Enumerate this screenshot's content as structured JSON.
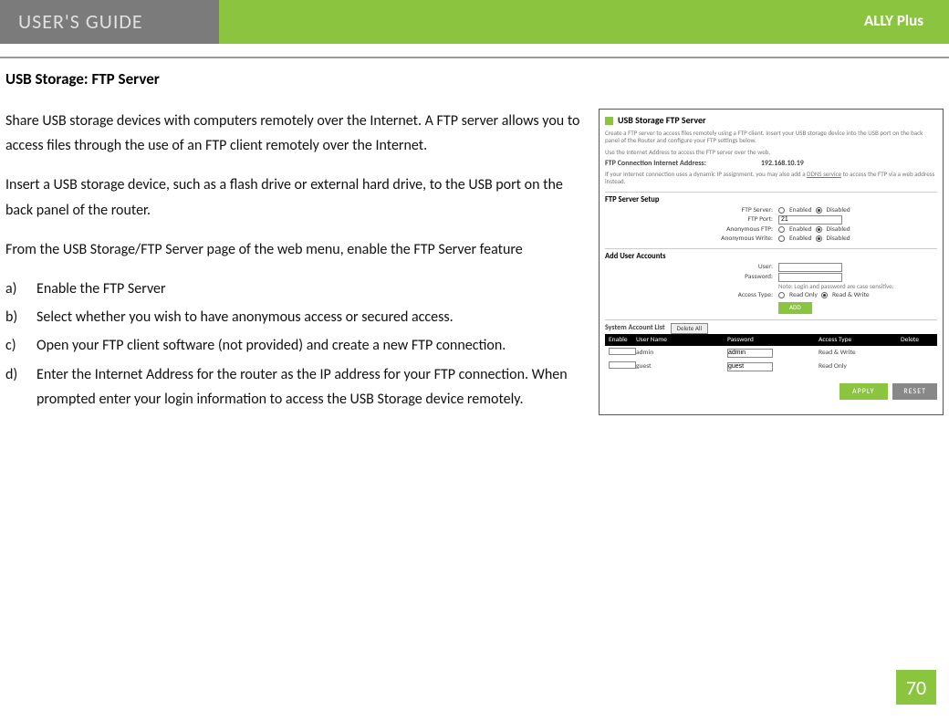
{
  "header": {
    "left": "USER'S GUIDE",
    "right": "ALLY Plus"
  },
  "section_title": "USB Storage: FTP Server",
  "para1": "Share USB storage devices with computers remotely over the Internet. A FTP server allows you to access files through the use of an FTP client remotely over the Internet.",
  "para2": "Insert a USB storage device, such as a flash drive or external hard drive, to the USB port on the back panel of the router.",
  "para3": "From the USB Storage/FTP Server page of the web menu, enable the FTP Server feature",
  "steps": [
    "Enable the FTP Server",
    "Select whether you wish to have anonymous access or secured access.",
    "Open your FTP client software (not provided) and create a new FTP connection.",
    "Enter the Internet Address for the router as the IP address for your FTP connection.  When prompted enter your login information to access the USB Storage device remotely."
  ],
  "step_markers": [
    "a)",
    "b)",
    "c)",
    "d)"
  ],
  "screenshot": {
    "title": "USB Storage FTP Server",
    "desc1": "Create a FTP server to access files remotely using a FTP client. Insert your USB storage device into the USB port on the back panel of the Router and configure your FTP settings below.",
    "desc2": "Use the Internet Address to access the FTP server over the web.",
    "addr_label": "FTP Connection Internet Address:",
    "addr_value": "192.168.10.19",
    "addr_note_pre": "If your Internet connection uses a dynamic IP assignment, you may also add a ",
    "addr_note_link": "DDNS service",
    "addr_note_post": " to access the FTP via a web address instead.",
    "setup_head": "FTP Server Setup",
    "rows": {
      "server": {
        "label": "FTP Server:",
        "enabled": "Enabled",
        "disabled": "Disabled"
      },
      "port": {
        "label": "FTP Port:",
        "value": "21"
      },
      "anonftp": {
        "label": "Anonymous FTP:",
        "enabled": "Enabled",
        "disabled": "Disabled"
      },
      "anonwrite": {
        "label": "Anonymous Write:",
        "enabled": "Enabled",
        "disabled": "Disabled"
      }
    },
    "add_head": "Add User Accounts",
    "user_label": "User:",
    "pass_label": "Password:",
    "note": "Note: Login and password are case sensitive.",
    "access_label": "Access Type:",
    "access_ro": "Read Only",
    "access_rw": "Read & Write",
    "add_btn": "ADD",
    "sys_head": "System Account List",
    "del_all": "Delete All",
    "thead": [
      "Enable",
      "User Name",
      "Password",
      "Access Type",
      "Delete"
    ],
    "trows": [
      {
        "user": "admin",
        "pass": "admin",
        "access": "Read & Write"
      },
      {
        "user": "guest",
        "pass": "guest",
        "access": "Read Only"
      }
    ],
    "apply": "APPLY",
    "reset": "RESET"
  },
  "page_number": "70"
}
